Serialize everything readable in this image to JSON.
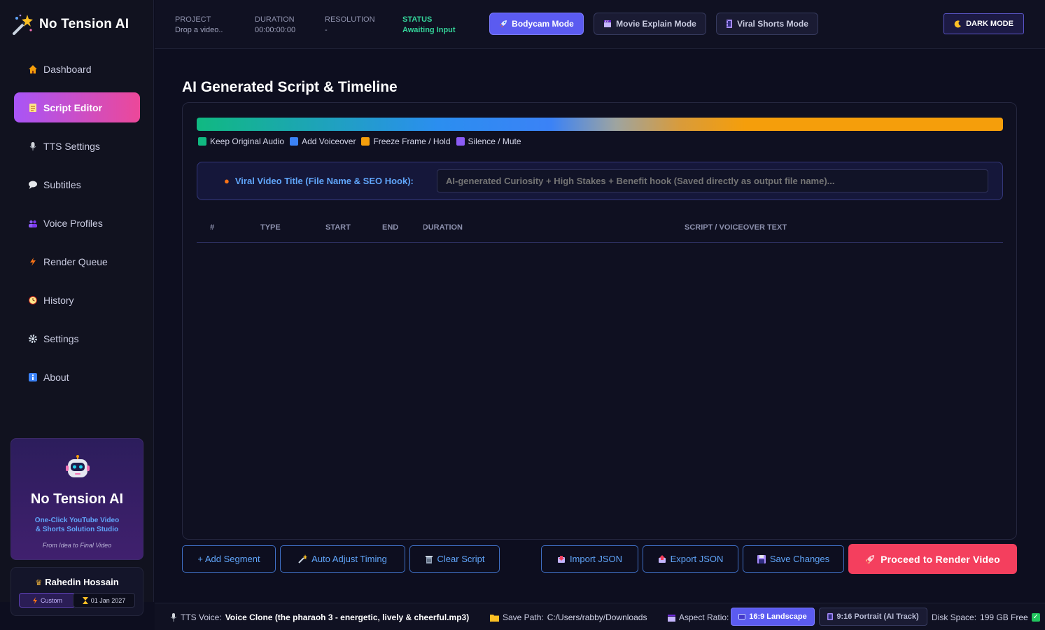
{
  "app": {
    "name": "No Tension AI"
  },
  "sidebar": {
    "items": [
      {
        "label": "Dashboard",
        "icon": "house-icon"
      },
      {
        "label": "Script Editor",
        "icon": "document-icon",
        "active": true
      },
      {
        "label": "TTS Settings",
        "icon": "microphone-icon"
      },
      {
        "label": "Subtitles",
        "icon": "speech-bubble-icon"
      },
      {
        "label": "Voice Profiles",
        "icon": "users-icon"
      },
      {
        "label": "Render Queue",
        "icon": "lightning-icon"
      },
      {
        "label": "History",
        "icon": "clock-icon"
      },
      {
        "label": "Settings",
        "icon": "gear-icon"
      },
      {
        "label": "About",
        "icon": "info-icon"
      }
    ],
    "promo": {
      "title": "No Tension AI",
      "subtitle_line1": "One-Click YouTube Video",
      "subtitle_line2": "& Shorts Solution Studio",
      "tagline": "From Idea to Final Video"
    },
    "user": {
      "name": "Rahedin Hossain",
      "plan": "Custom",
      "expiry": "01 Jan 2027"
    }
  },
  "header": {
    "project": {
      "label": "PROJECT",
      "value": "Drop a video.."
    },
    "duration": {
      "label": "DURATION",
      "value": "00:00:00:00"
    },
    "resolution": {
      "label": "RESOLUTION",
      "value": "-"
    },
    "status": {
      "label": "STATUS",
      "value": "Awaiting Input"
    },
    "modes": [
      {
        "label": "Bodycam Mode",
        "active": true
      },
      {
        "label": "Movie Explain Mode",
        "active": false
      },
      {
        "label": "Viral Shorts Mode",
        "active": false
      }
    ],
    "theme_toggle": "DARK MODE"
  },
  "main": {
    "title": "AI Generated Script & Timeline",
    "legend": [
      {
        "label": "Keep Original Audio",
        "color": "#10b981"
      },
      {
        "label": "Add Voiceover",
        "color": "#3b82f6"
      },
      {
        "label": "Freeze Frame / Hold",
        "color": "#f59e0b"
      },
      {
        "label": "Silence / Mute",
        "color": "#8b5cf6"
      }
    ],
    "seo": {
      "label": "Viral Video Title (File Name & SEO Hook):",
      "placeholder": "AI-generated Curiosity + High Stakes + Benefit hook (Saved directly as output file name)..."
    },
    "table": {
      "columns": [
        "#",
        "TYPE",
        "START",
        "END",
        "DURATION",
        "SCRIPT / VOICEOVER TEXT"
      ],
      "rows": []
    },
    "actions": {
      "add_segment": "+ Add Segment",
      "auto_adjust": "Auto Adjust Timing",
      "clear_script": "Clear Script",
      "import_json": "Import JSON",
      "export_json": "Export JSON",
      "save_changes": "Save Changes",
      "render": "Proceed to Render Video"
    }
  },
  "footer": {
    "tts_label": "TTS Voice:",
    "tts_value": "Voice Clone (the pharaoh 3 - energetic, lively & cheerful.mp3)",
    "save_label": "Save Path:",
    "save_value": "C:/Users/rabby/Downloads",
    "aspect_label": "Aspect Ratio:",
    "aspect_options": [
      "16:9 Landscape",
      "9:16 Portrait (AI Track)"
    ],
    "disk_label": "Disk Space:",
    "disk_value": "199 GB Free"
  },
  "colors": {
    "accent": "#5b5bf0",
    "active_nav_start": "#a855f7",
    "active_nav_end": "#ec4899",
    "render": "#f43f5e",
    "status": "#34d399",
    "link_blue": "#60a5fa"
  }
}
